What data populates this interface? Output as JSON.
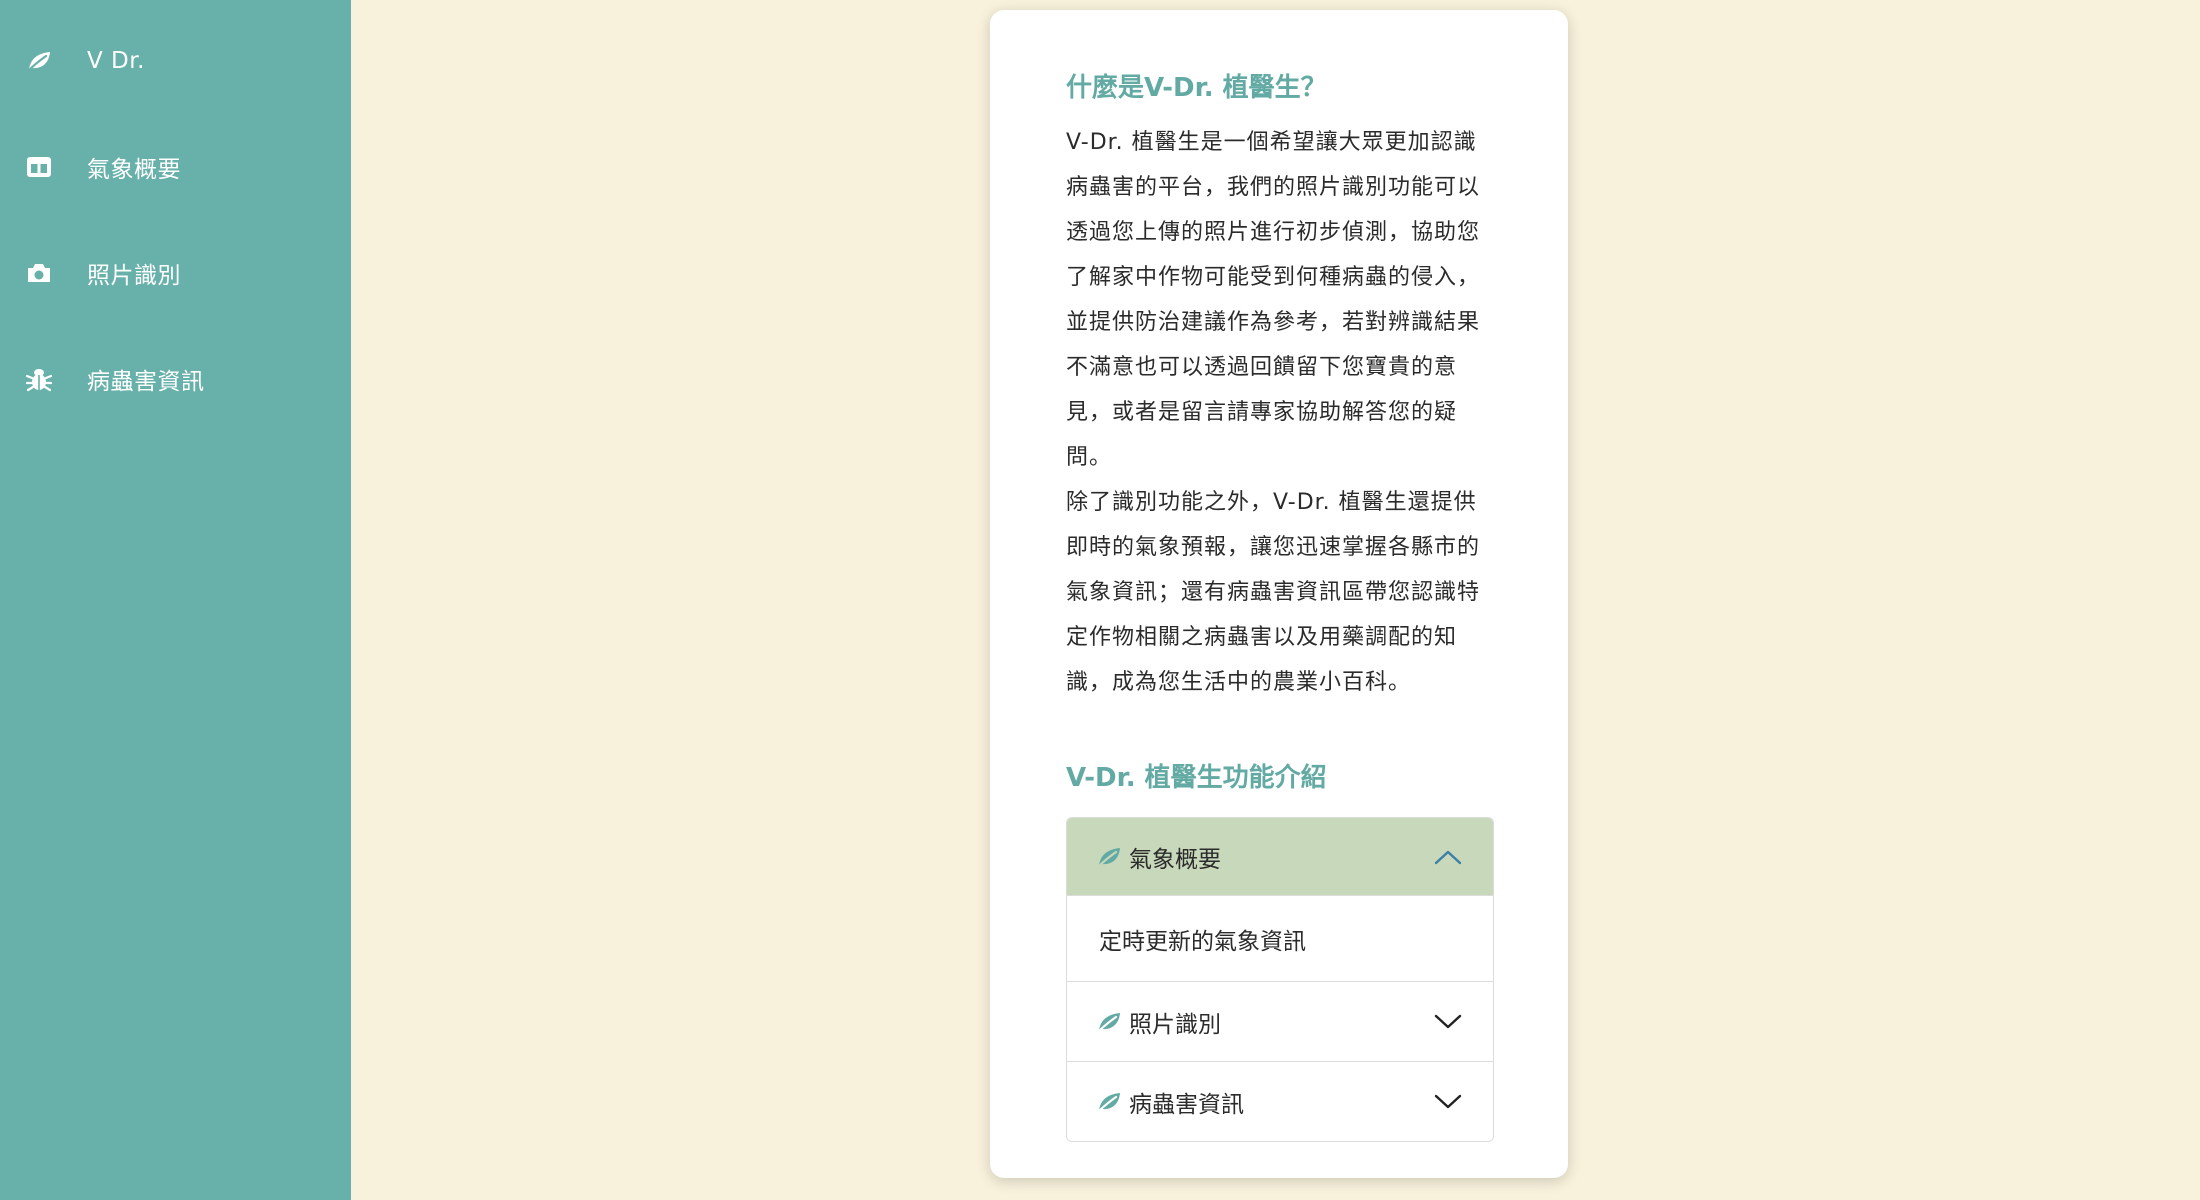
{
  "sidebar": {
    "items": [
      {
        "label": "V Dr.",
        "icon": "leaf-icon"
      },
      {
        "label": "氣象概要",
        "icon": "layout-icon"
      },
      {
        "label": "照片識別",
        "icon": "camera-icon"
      },
      {
        "label": "病蟲害資訊",
        "icon": "bug-icon"
      }
    ]
  },
  "main": {
    "about_title": "什麼是V-Dr. 植醫生？",
    "paragraphs": [
      "V-Dr. 植醫生是一個希望讓大眾更加認識病蟲害的平台，我們的照片識別功能可以透過您上傳的照片進行初步偵測，協助您了解家中作物可能受到何種病蟲的侵入，並提供防治建議作為參考，若對辨識結果不滿意也可以透過回饋留下您寶貴的意見，或者是留言請專家協助解答您的疑問。",
      "除了識別功能之外，V-Dr. 植醫生還提供即時的氣象預報，讓您迅速掌握各縣市的氣象資訊；還有病蟲害資訊區帶您認識特定作物相關之病蟲害以及用藥調配的知識，成為您生活中的農業小百科。"
    ],
    "features_title": "V-Dr. 植醫生功能介紹",
    "accordion": [
      {
        "label": "氣象概要",
        "expanded": true,
        "body": "定時更新的氣象資訊"
      },
      {
        "label": "照片識別",
        "expanded": false
      },
      {
        "label": "病蟲害資訊",
        "expanded": false
      }
    ]
  },
  "colors": {
    "sidebar_bg": "#68b1aa",
    "page_bg": "#f8f2dc",
    "accent": "#62aaa3",
    "accordion_open_bg": "#c8d8bb",
    "chevron_up": "#3d7fa8"
  }
}
